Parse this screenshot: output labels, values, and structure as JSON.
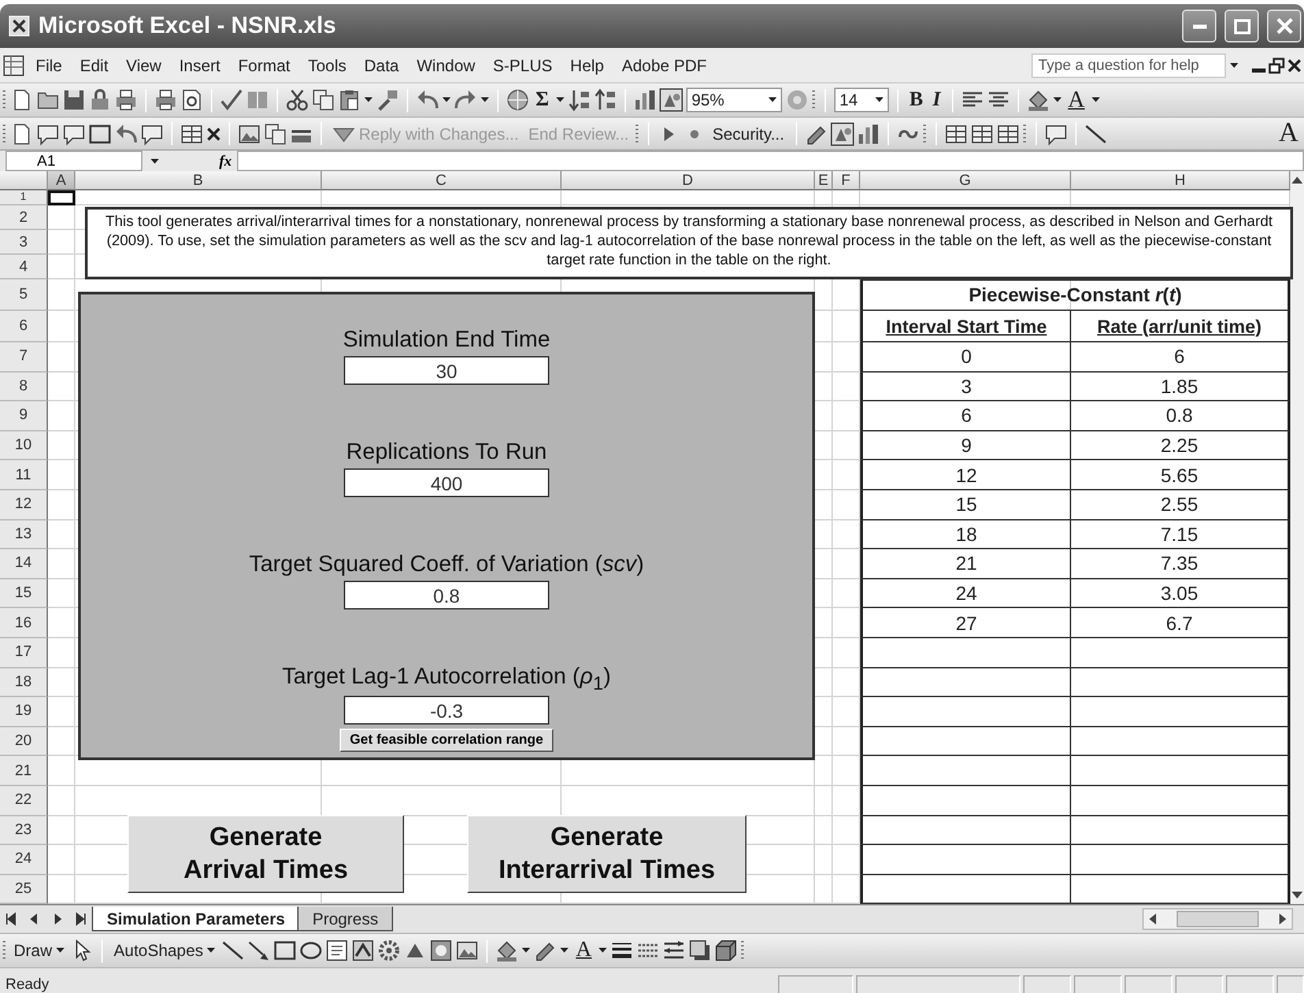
{
  "window": {
    "title": "Microsoft Excel - NSNR.xls"
  },
  "menu_bar": {
    "items": [
      "File",
      "Edit",
      "View",
      "Insert",
      "Format",
      "Tools",
      "Data",
      "Window",
      "S-PLUS",
      "Help",
      "Adobe PDF"
    ],
    "help_search": {
      "placeholder": "Type a question for help"
    }
  },
  "standard_toolbar": {
    "sum": "Σ",
    "zoom": "95%",
    "font_size": "14",
    "bold": "B",
    "italic": "I",
    "font_color": "A"
  },
  "reviewing_toolbar": {
    "reply_with_changes": {
      "label": "Reply with Changes...",
      "disabled": true
    },
    "end_review": {
      "label": "End Review...",
      "disabled": true
    },
    "security": "Security...",
    "wordart": "A"
  },
  "formula_bar": {
    "name_box": "A1",
    "function_label": "fx"
  },
  "sheet": {
    "columns": [
      "A",
      "B",
      "C",
      "D",
      "E",
      "F",
      "G",
      "H"
    ],
    "rows": [
      "1",
      "2",
      "3",
      "4",
      "5",
      "6",
      "7",
      "8",
      "9",
      "10",
      "11",
      "12",
      "13",
      "14",
      "15",
      "16",
      "17",
      "18",
      "19",
      "20",
      "21",
      "22",
      "23",
      "24",
      "25"
    ],
    "description": "This tool generates arrival/interarrival times for a nonstationary, nonrenewal process by transforming a stationary base nonrenewal process, as described in Nelson and Gerhardt (2009).  To use, set the simulation parameters as well as the scv and lag-1 autocorrelation of the base nonrewal process in the table on the left, as well as the piecewise-constant target rate function in the table on the right.",
    "panel": {
      "fields": [
        {
          "label": "Simulation End Time",
          "value": "30"
        },
        {
          "label": "Replications To Run",
          "value": "400"
        },
        {
          "label": "Target Squared Coeff. of Variation (*scv*)",
          "value": "0.8"
        },
        {
          "label": "Target Lag-1 Autocorrelation (*ρ*$_{1}$)",
          "value": "-0.3"
        }
      ],
      "range_button": "Get feasible correlation range"
    },
    "buttons": [
      {
        "lines": [
          "Generate",
          "Arrival Times"
        ]
      },
      {
        "lines": [
          "Generate",
          "Interarrival Times"
        ]
      }
    ],
    "rate_table": {
      "title": "Piecewise-Constant *r*(*t*)",
      "columns": [
        "Interval Start Time",
        "Rate (arr/unit time)"
      ],
      "rows": [
        [
          "0",
          "6"
        ],
        [
          "3",
          "1.85"
        ],
        [
          "6",
          "0.8"
        ],
        [
          "9",
          "2.25"
        ],
        [
          "12",
          "5.65"
        ],
        [
          "15",
          "2.55"
        ],
        [
          "18",
          "7.15"
        ],
        [
          "21",
          "7.35"
        ],
        [
          "24",
          "3.05"
        ],
        [
          "27",
          "6.7"
        ]
      ]
    }
  },
  "sheet_tabs": [
    {
      "label": "Simulation Parameters",
      "selected": true
    },
    {
      "label": "Progress",
      "selected": false
    }
  ],
  "drawing_toolbar": {
    "draw": "Draw",
    "autoshapes": "AutoShapes",
    "font_color": "A"
  },
  "status_bar": {
    "text": "Ready"
  }
}
